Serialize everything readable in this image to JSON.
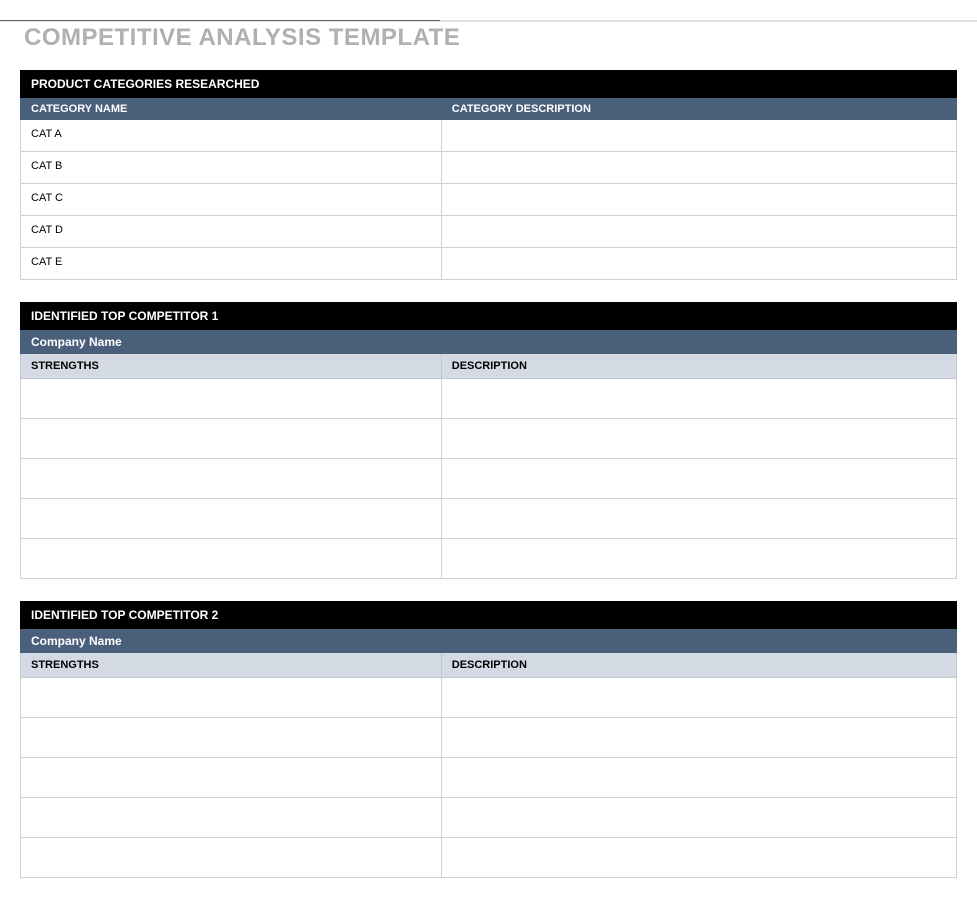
{
  "title": "COMPETITIVE ANALYSIS TEMPLATE",
  "categories_section": {
    "header": "PRODUCT CATEGORIES RESEARCHED",
    "col1": "CATEGORY NAME",
    "col2": "CATEGORY DESCRIPTION",
    "rows": [
      {
        "name": "CAT A",
        "desc": ""
      },
      {
        "name": "CAT B",
        "desc": ""
      },
      {
        "name": "CAT C",
        "desc": ""
      },
      {
        "name": "CAT D",
        "desc": ""
      },
      {
        "name": "CAT E",
        "desc": ""
      }
    ]
  },
  "competitor1": {
    "header": "IDENTIFIED TOP COMPETITOR 1",
    "company_label": "Company Name",
    "col1": "STRENGTHS",
    "col2": "DESCRIPTION",
    "rows": [
      {
        "strength": "",
        "desc": ""
      },
      {
        "strength": "",
        "desc": ""
      },
      {
        "strength": "",
        "desc": ""
      },
      {
        "strength": "",
        "desc": ""
      },
      {
        "strength": "",
        "desc": ""
      }
    ]
  },
  "competitor2": {
    "header": "IDENTIFIED TOP COMPETITOR 2",
    "company_label": "Company Name",
    "col1": "STRENGTHS",
    "col2": "DESCRIPTION",
    "rows": [
      {
        "strength": "",
        "desc": ""
      },
      {
        "strength": "",
        "desc": ""
      },
      {
        "strength": "",
        "desc": ""
      },
      {
        "strength": "",
        "desc": ""
      },
      {
        "strength": "",
        "desc": ""
      }
    ]
  }
}
